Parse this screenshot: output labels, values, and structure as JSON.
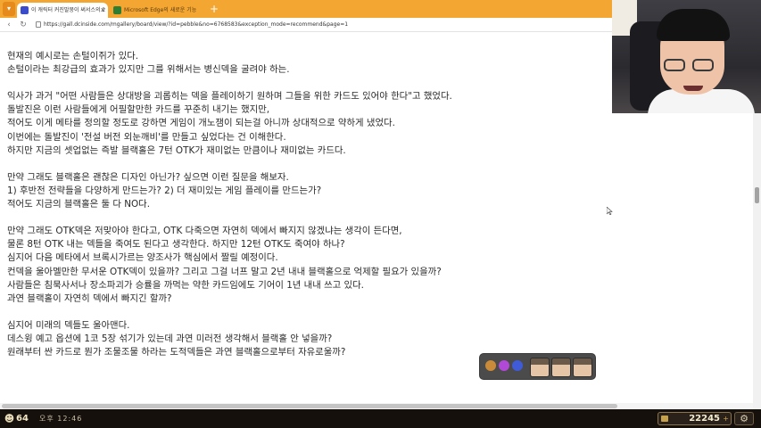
{
  "browser": {
    "menu_icon": "logo-menu-icon",
    "tabs": [
      {
        "label": "이 캐릭터 커진말뭉이 써서스의 2",
        "active": true
      },
      {
        "label": "Microsoft Edge의 새로운 기능",
        "active": false
      }
    ],
    "tab_close_glyph": "x",
    "new_tab_glyph": "+",
    "back_glyph": "‹",
    "refresh_glyph": "↻",
    "url": "https://gall.dcinside.com/mgallery/board/view/?id=pebble&no=6768583&exception_mode=recommend&page=1"
  },
  "article": {
    "lines": [
      "현재의 예시로는 손털이쥐가 있다.",
      "손털이라는 최강급의 효과가 있지만 그를 위해서는 병신덱을 굴려야 하는.",
      "",
      "익사가 과거 \"어떤 사람들은 상대방을 괴롭히는 덱을 플레이하기 원하며 그들을 위한 카드도 있어야 한다\"고 했었다.",
      "돌발진은 이런 사람들에게 어필할만한 카드를 꾸준히 내기는 했지만,",
      "적어도 이게 메타를 정의할 정도로 강하면 게임이 개노잼이 되는걸 아니까 상대적으로 약하게 냈었다.",
      "이번에는 돌발진이 '전설 버전 외눈깨비'를 만들고 싶었다는 건 이해한다.",
      "하지만 지금의 셋업없는 즉발 블랙홀은 7턴 OTK가 재미없는 만큼이나 재미없는 카드다.",
      "",
      "만약 그래도 블랙홀은 괜찮은 디자인 아닌가? 싶으면 이런 질문을 해보자.",
      "1) 후반전 전략들을 다양하게 만드는가? 2) 더 재미있는 게임 플레이를 만드는가?",
      "적어도 지금의 블랙홀은 둘 다 NO다.",
      "",
      "만약 그래도 OTK덱은 저맞아야 한다고, OTK 다죽으면 자연히 덱에서 빠지지 않겠냐는 생각이 든다면,",
      "물론 8턴 OTK 내는 덱들을 죽여도 된다고 생각한다. 하지만 12턴 OTK도 죽여야 하나?",
      "심지어 다음 메타에서 브록시가르는 양조사가 핵심에서 짤릴 예정이다.",
      "컨덱을 울아멜만한 무서운 OTK덱이 있을까? 그리고 그걸 너프 말고 2년 내내 블랙홀으로 억제할 필요가 있을까?",
      "사람들은 침묵사서나 장소파괴가 승률을 까먹는 약한 카드임에도 기어이 1년 내내 쓰고 있다.",
      "과연 블랙홀이 자연히 덱에서 빠지긴 할까?",
      "",
      "심지어 미래의 덱들도 울아맨다.",
      "데스윙 예고 옵션에 1코 5장 섞기가 있는데 과연 미러전 생각해서 블랙홀 안 넣을까?",
      "원래부터 싼 카드로 뭔가 조물조물 하라는 도적덱들은 과연 블랙홀으로부터 자유로울까?"
    ]
  },
  "stream_overlay": {
    "reaction_emotes": [
      "cookie-emote-icon",
      "heart-emote-icon",
      "badge-emote-icon"
    ],
    "emote_colors": [
      "#c98a3a",
      "#b04ad6",
      "#3f5bd8"
    ],
    "viewer_faces": [
      "viewer-face-1",
      "viewer-face-2",
      "viewer-face-3"
    ],
    "viewers": "64",
    "time": "오후 12:46",
    "score": "22245",
    "score_plus": "+",
    "gear_glyph": "⚙",
    "viewers_glyph": "☻"
  }
}
